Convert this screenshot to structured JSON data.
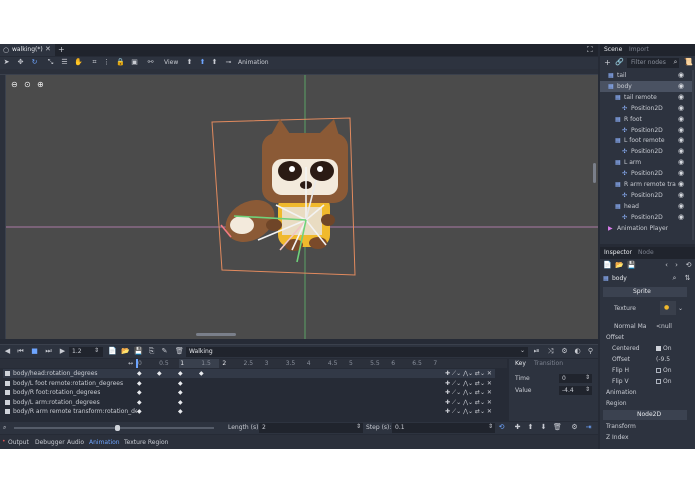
{
  "tabs": {
    "active": "walking(*)",
    "add": "+"
  },
  "toolbar": {
    "view": "View",
    "animation": "Animation"
  },
  "scene_dock": {
    "tab_scene": "Scene",
    "tab_import": "Import",
    "filter_placeholder": "Filter nodes",
    "nodes": [
      {
        "label": "tail",
        "indent": 1
      },
      {
        "label": "body",
        "indent": 1
      },
      {
        "label": "tail remote",
        "indent": 2
      },
      {
        "label": "Position2D",
        "indent": 3
      },
      {
        "label": "R foot",
        "indent": 2
      },
      {
        "label": "Position2D",
        "indent": 3
      },
      {
        "label": "L foot remote",
        "indent": 2
      },
      {
        "label": "Position2D",
        "indent": 3
      },
      {
        "label": "L arm",
        "indent": 2
      },
      {
        "label": "Position2D",
        "indent": 3
      },
      {
        "label": "R arm remote tra",
        "indent": 2
      },
      {
        "label": "Position2D",
        "indent": 3
      },
      {
        "label": "head",
        "indent": 2
      },
      {
        "label": "Position2D",
        "indent": 3
      },
      {
        "label": "Animation Player",
        "indent": 1
      }
    ]
  },
  "inspector": {
    "tab_inspector": "Inspector",
    "tab_node": "Node",
    "object": "body",
    "class_btn": "Sprite",
    "texture_label": "Texture",
    "normal_label": "Normal Ma",
    "normal_value": "<null",
    "offset_section": "Offset",
    "centered_label": "Centered",
    "centered_value": "On",
    "offset_label": "Offset",
    "offset_value": "(-9.5",
    "fliph_label": "Flip H",
    "fliph_value": "On",
    "flipv_label": "Flip V",
    "flipv_value": "On",
    "animation_section": "Animation",
    "region_section": "Region",
    "node2d_btn": "Node2D",
    "transform_section": "Transform",
    "zindex_section": "Z Index"
  },
  "anim": {
    "speed": "1.2",
    "name": "Walking",
    "ruler": [
      "0",
      "0.5",
      "1",
      "1.5",
      "2",
      "2.5",
      "3",
      "3.5",
      "4",
      "4.5",
      "5",
      "5.5",
      "6",
      "6.5",
      "7"
    ],
    "tracks": [
      "body/head:rotation_degrees",
      "body/L foot remote:rotation_degrees",
      "body/R foot:rotation_degrees",
      "body/L arm:rotation_degrees",
      "body/R arm remote transform:rotation_de"
    ],
    "length_label": "Length (s):",
    "length_value": "2",
    "step_label": "Step (s):",
    "step_value": "0.1",
    "key_tab": "Key",
    "transition_tab": "Transition",
    "time_label": "Time",
    "time_value": "0",
    "value_label": "Value",
    "value_value": "-4.4"
  },
  "bottom_tabs": [
    "Output",
    "Debugger",
    "Audio",
    "Animation",
    "Texture Region"
  ]
}
